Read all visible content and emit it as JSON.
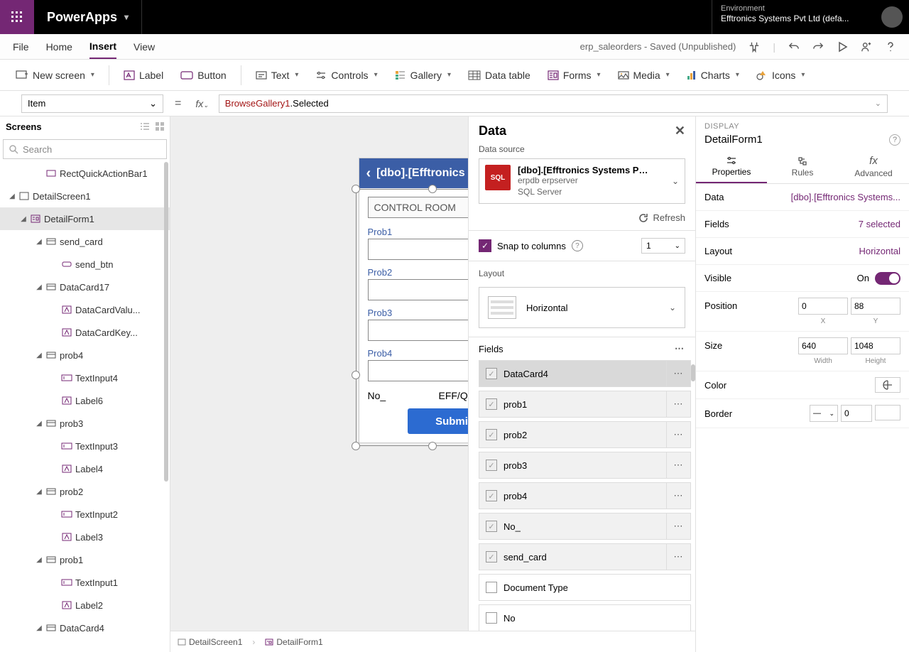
{
  "top": {
    "appname": "PowerApps",
    "env_label": "Environment",
    "env_value": "Efftronics Systems Pvt Ltd (defa..."
  },
  "menu": {
    "file": "File",
    "home": "Home",
    "insert": "Insert",
    "view": "View",
    "saved": "erp_saleorders - Saved (Unpublished)"
  },
  "ribbon": {
    "newscreen": "New screen",
    "label": "Label",
    "button": "Button",
    "text": "Text",
    "controls": "Controls",
    "gallery": "Gallery",
    "datatable": "Data table",
    "forms": "Forms",
    "media": "Media",
    "charts": "Charts",
    "icons": "Icons"
  },
  "formula": {
    "prop": "Item",
    "token1": "BrowseGallery1",
    "token2": ".Selected"
  },
  "leftpane": {
    "title": "Screens",
    "search_placeholder": "Search",
    "nodes": {
      "rect": "RectQuickActionBar1",
      "detailscreen": "DetailScreen1",
      "detailform": "DetailForm1",
      "send_card": "send_card",
      "send_btn": "send_btn",
      "datacard17": "DataCard17",
      "datacardvalu": "DataCardValu...",
      "datacardkey": "DataCardKey...",
      "prob4": "prob4",
      "textinput4": "TextInput4",
      "label6": "Label6",
      "prob3": "prob3",
      "textinput3": "TextInput3",
      "label4": "Label4",
      "prob2": "prob2",
      "textinput2": "TextInput2",
      "label3": "Label3",
      "prob1": "prob1",
      "textinput1": "TextInput1",
      "label2": "Label2",
      "datacard4": "DataCard4"
    }
  },
  "phone": {
    "header": "[dbo].[Efftronics Sy",
    "control_room": "CONTROL ROOM",
    "p1": "Prob1",
    "p2": "Prob2",
    "p3": "Prob3",
    "p4": "Prob4",
    "no": "No_",
    "noval": "EFF/QT/SAL/",
    "submit": "Submit"
  },
  "bcrumb": {
    "b1": "DetailScreen1",
    "b2": "DetailForm1"
  },
  "flyout": {
    "title": "Data",
    "ds_label": "Data source",
    "ds_title": "[dbo].[Efftronics Systems Pvt Ltd_...",
    "ds_sub1": "erpdb erpserver",
    "ds_sub2": "SQL Server",
    "refresh": "Refresh",
    "snap": "Snap to columns",
    "snap_val": "1",
    "layout": "Layout",
    "layout_val": "Horizontal",
    "fields": "Fields",
    "field_items": [
      "DataCard4",
      "prob1",
      "prob2",
      "prob3",
      "prob4",
      "No_",
      "send_card",
      "Document Type",
      "No"
    ]
  },
  "rp": {
    "display": "DISPLAY",
    "objname": "DetailForm1",
    "tab_props": "Properties",
    "tab_rules": "Rules",
    "tab_adv": "Advanced",
    "data": "Data",
    "data_val": "[dbo].[Efftronics Systems...",
    "fields": "Fields",
    "fields_val": "7 selected",
    "layout": "Layout",
    "layout_val": "Horizontal",
    "visible": "Visible",
    "visible_val": "On",
    "position": "Position",
    "x": "0",
    "xlab": "X",
    "y": "88",
    "ylab": "Y",
    "size": "Size",
    "w": "640",
    "wlab": "Width",
    "h": "1048",
    "hlab": "Height",
    "color": "Color",
    "border": "Border",
    "border_val": "0"
  }
}
